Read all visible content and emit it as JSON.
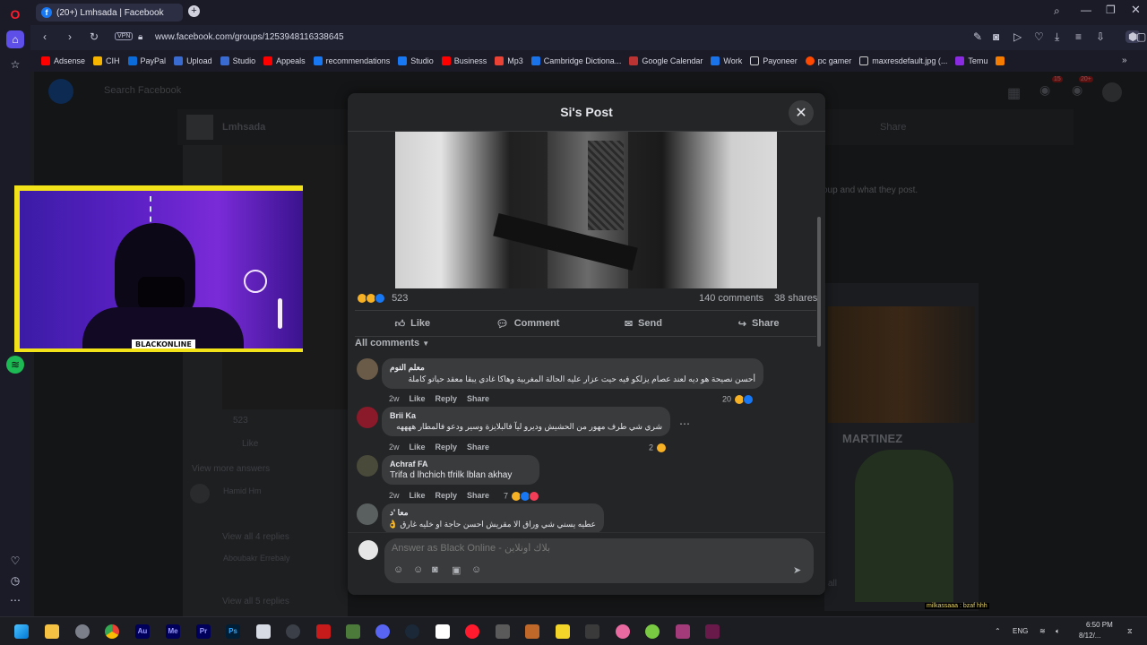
{
  "browser": {
    "tab_title": "(20+) Lmhsada | Facebook",
    "url": "www.facebook.com/groups/1253948116338645",
    "vpn_label": "VPN",
    "bookmarks": [
      "Adsense",
      "CIH",
      "PayPal",
      "Upload",
      "Studio",
      "Appeals",
      "recommendations",
      "Studio",
      "Business",
      "Mp3",
      "Cambridge Dictiona...",
      "Google Calendar",
      "Work",
      "Payoneer",
      "pc gamer",
      "maxresdefault.jpg (...",
      "Temu"
    ]
  },
  "background_page": {
    "search_placeholder": "Search Facebook",
    "group_name": "Lmhsada",
    "share_label": "Share",
    "about_text": "oup and what they post.",
    "reactions_count": "523",
    "like_label": "Like",
    "view_more": "View more answers",
    "commenter1": "Hamid Hm",
    "view_all_4": "View all 4 replies",
    "commenter2": "Aboubakr Errebaly",
    "view_all_5": "View all 5 replies",
    "ad_label": "MARTINEZ",
    "all_label": "all",
    "notif_badge_1": "15",
    "notif_badge_2": "20+"
  },
  "modal": {
    "title": "Si's Post",
    "reactions_count": "523",
    "comments_count": "140 comments",
    "shares_count": "38 shares",
    "actions": {
      "like": "Like",
      "comment": "Comment",
      "send": "Send",
      "share": "Share"
    },
    "filter_label": "All comments",
    "comments": [
      {
        "name": "ﻣﻌﻠﻢ ﺍﻟﻨﻮﻡ",
        "text": "أحسن نصيحة هو ديه لعند عصام يزلكو فيه حيت عزار عليه الحالة المغربية وهاكا غادي يبقا معقد حياتو كاملة",
        "age": "2w",
        "reactions": "20"
      },
      {
        "name": "Brii Ka",
        "text": "شري شي طرف مهور من الحشيش وديرو ليآ فالبلايزة وسير ودعو فالمطار ههههه",
        "age": "2w",
        "reactions": "2"
      },
      {
        "name": "Achraf FA",
        "text": "Trifa d lhchich tfrilk lblan akhay",
        "age": "2w",
        "reactions": "7"
      },
      {
        "name": "معا 'د",
        "text": "عطيه يسني شي وراق الا مقريش احسن حاجة او خليه غارق 👌",
        "age": "",
        "reactions": ""
      }
    ],
    "meta_labels": {
      "like": "Like",
      "reply": "Reply",
      "share": "Share"
    },
    "answer_placeholder": "Answer as Black Online - بلاك أونلاين"
  },
  "stream": {
    "cam_label": "BLACKONLINE",
    "chat_line": "milkassaaa : bzaf hhh"
  },
  "taskbar": {
    "lang": "ENG",
    "time": "6:50 PM",
    "date": "8/12/..."
  },
  "colors": {
    "accent": "#1877f2",
    "cam_frame": "#f2e21a",
    "modal_bg": "#242526"
  }
}
